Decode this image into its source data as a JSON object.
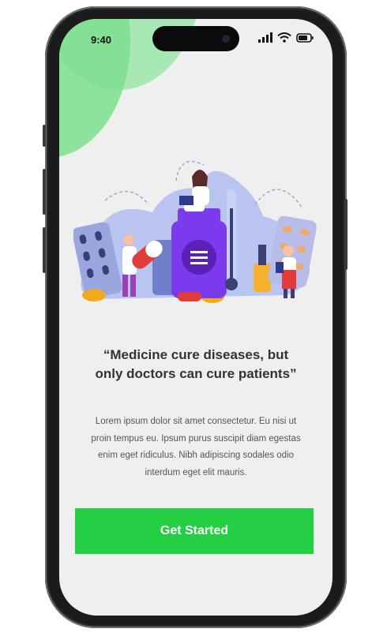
{
  "status_bar": {
    "time": "9:40",
    "icons": [
      "signal-icon",
      "wifi-icon",
      "battery-icon"
    ]
  },
  "illustration": {
    "name": "doctors-medicine-illustration"
  },
  "quote": {
    "line1": "“Medicine cure diseases, but",
    "line2": "only doctors can cure patients”"
  },
  "description": "Lorem ipsum dolor sit amet consectetur. Eu nisi ut proin tempus eu. Ipsum purus suscipit diam egestas enim eget ridiculus. Nibh adipiscing sodales odio interdum eget elit mauris.",
  "cta": {
    "label": "Get Started"
  },
  "colors": {
    "accent": "#25cf44",
    "blob": "#7ddf8f",
    "background": "#efefef"
  }
}
